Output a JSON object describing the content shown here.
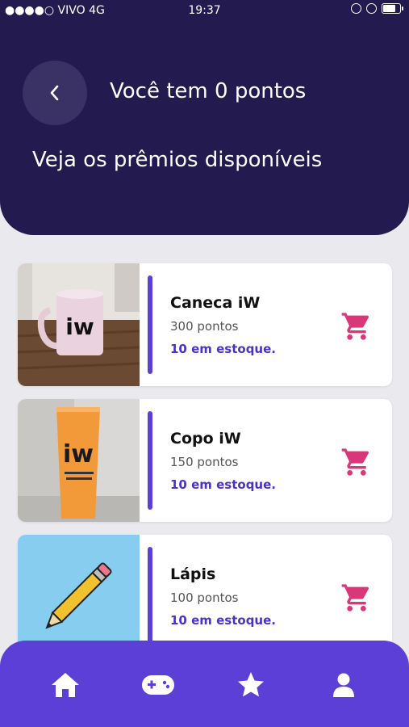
{
  "status_bar": {
    "carrier": "VIVO",
    "network": "4G",
    "time": "19:37"
  },
  "header": {
    "title": "Você tem 0 pontos",
    "subtitle": "Veja os prêmios disponíveis"
  },
  "prizes": [
    {
      "name": "Caneca iW",
      "points": "300 pontos",
      "stock": "10 em estoque."
    },
    {
      "name": "Copo iW",
      "points": "150 pontos",
      "stock": "10 em estoque."
    },
    {
      "name": "Lápis",
      "points": "100 pontos",
      "stock": "10 em estoque."
    }
  ],
  "colors": {
    "header_bg": "#231a4f",
    "accent": "#5b3fd6",
    "cart": "#d9377a",
    "stock_text": "#4a32c8"
  },
  "nav": {
    "items": [
      "home-icon",
      "gamepad-icon",
      "star-icon",
      "user-icon"
    ]
  }
}
